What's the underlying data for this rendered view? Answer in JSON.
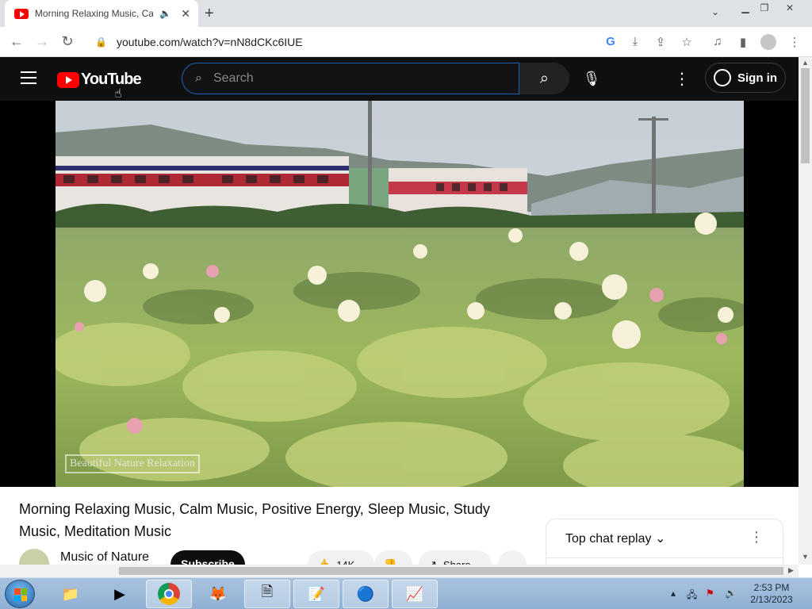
{
  "browser": {
    "tab_title": "Morning Relaxing Music, Calm Music",
    "url": "youtube.com/watch?v=nN8dCKc6IUE",
    "icons": [
      "back-icon",
      "forward-icon",
      "reload-icon",
      "lock-icon",
      "google-icon",
      "install-icon",
      "share-icon",
      "star-icon",
      "media-icon",
      "sidepanel-icon",
      "profile-icon",
      "menu-icon"
    ]
  },
  "youtube": {
    "logo_text": "YouTube",
    "search_placeholder": "Search",
    "signin_label": "Sign in",
    "watermark": "Beautiful Nature Relaxation",
    "video_title": "Morning Relaxing Music, Calm Music, Positive Energy, Sleep Music, Study Music, Meditation Music",
    "channel_name": "Music of Nature",
    "subscribe_label": "Subscribe",
    "like_count": "14K",
    "share_label": "Share",
    "chat_label": "Top chat replay"
  },
  "taskbar": {
    "time": "2:53 PM",
    "date": "2/13/2023"
  },
  "colors": {
    "yt_red": "#ff0000",
    "yt_dark": "#0f0f0f",
    "chrome_tabbar": "#dee1e6",
    "taskbar": "#8fb0d4"
  }
}
